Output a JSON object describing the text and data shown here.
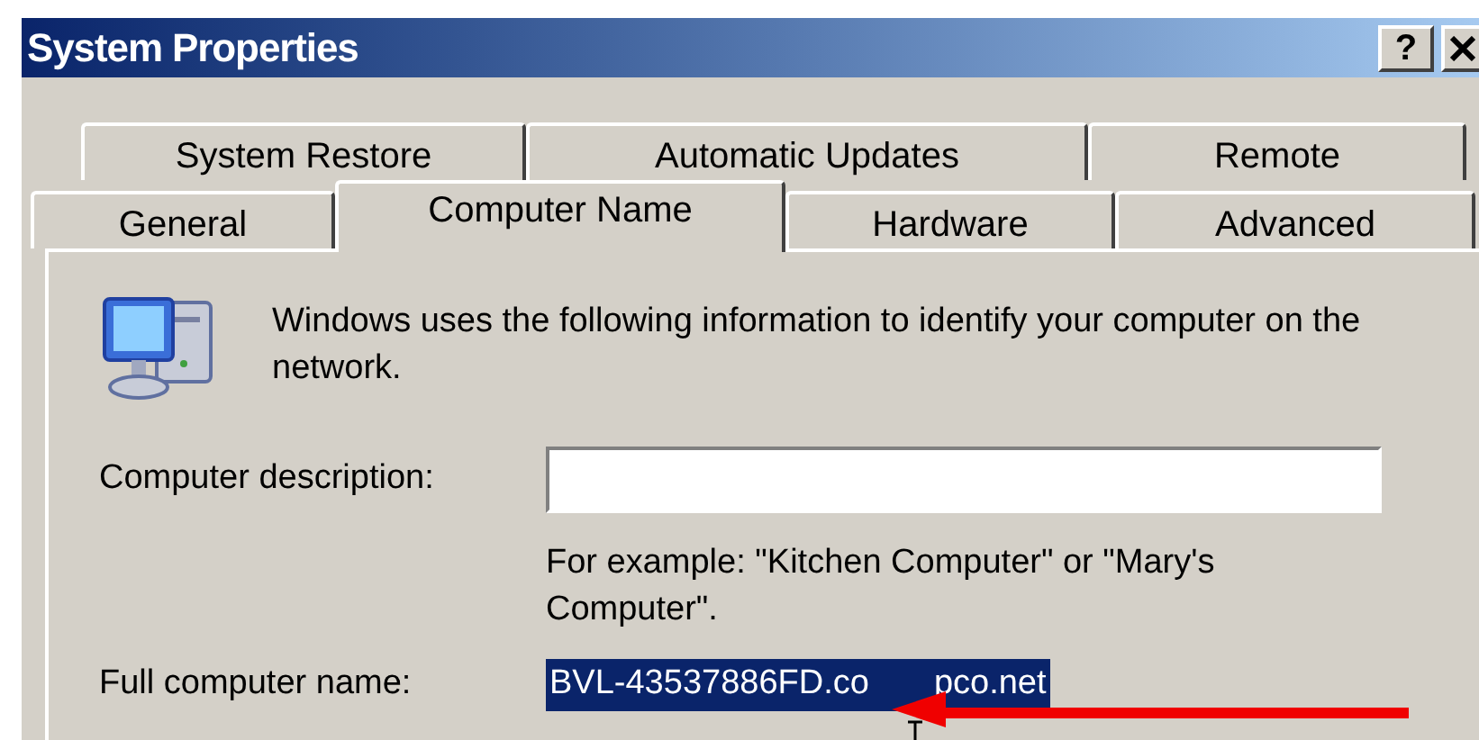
{
  "window": {
    "title": "System Properties",
    "help_button": "?"
  },
  "tab_rows": [
    [
      {
        "label": "System Restore",
        "selected": false
      },
      {
        "label": "Automatic Updates",
        "selected": false
      },
      {
        "label": "Remote",
        "selected": false
      }
    ],
    [
      {
        "label": "General",
        "selected": false
      },
      {
        "label": "Computer Name",
        "selected": true
      },
      {
        "label": "Hardware",
        "selected": false
      },
      {
        "label": "Advanced",
        "selected": false
      }
    ]
  ],
  "intro": "Windows uses the following information to identify your computer on the network.",
  "description": {
    "label": "Computer description:"
  },
  "example": "For example: \"Kitchen Computer\" or \"Mary's Computer\".",
  "full_name": {
    "label": "Full computer name:",
    "value": "BVL-43537886FD.co",
    "value_continued": "pco.net",
    "selected": true
  }
}
